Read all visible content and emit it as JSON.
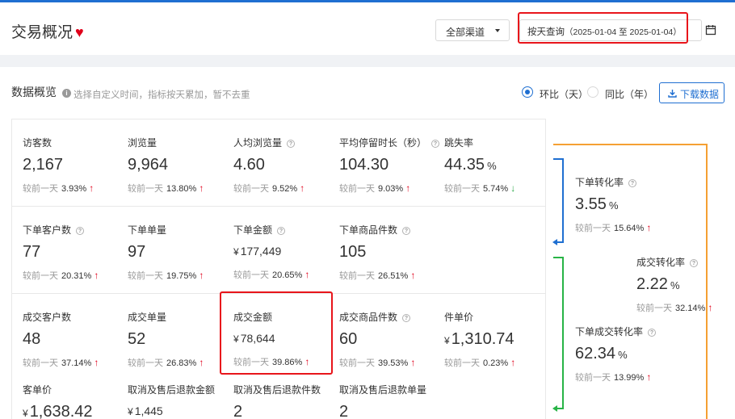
{
  "header": {
    "title": "交易概况",
    "channel": "全部渠道",
    "date_mode": "按天查询",
    "date_range": "（2025-01-04 至 2025-01-04）"
  },
  "overview": {
    "title": "数据概览",
    "hint": "选择自定义时间，指标按天累加，暂不去重",
    "compare_options": [
      {
        "label": "环比（天）",
        "selected": true
      },
      {
        "label": "同比（年）",
        "selected": false
      }
    ],
    "download_label": "下载数据",
    "compare_prefix": "较前一天"
  },
  "metrics": [
    {
      "label": "访客数",
      "value": "2,167",
      "change": "3.93%",
      "dir": "up"
    },
    {
      "label": "浏览量",
      "value": "9,964",
      "change": "13.80%",
      "dir": "up"
    },
    {
      "label": "人均浏览量",
      "value": "4.60",
      "change": "9.52%",
      "dir": "up"
    },
    {
      "label": "平均停留时长（秒）",
      "value": "104.30",
      "change": "9.03%",
      "dir": "up"
    },
    {
      "label": "跳失率",
      "value": "44.35",
      "unit": "%",
      "change": "5.74%",
      "dir": "down"
    },
    {
      "label": "下单客户数",
      "value": "77",
      "change": "20.31%",
      "dir": "up"
    },
    {
      "label": "下单单量",
      "value": "97",
      "change": "19.75%",
      "dir": "up"
    },
    {
      "label": "下单金额",
      "value": "177,449",
      "currency": "¥",
      "change": "20.65%",
      "dir": "up"
    },
    {
      "label": "下单商品件数",
      "value": "105",
      "change": "26.51%",
      "dir": "up"
    },
    {
      "label": "成交客户数",
      "value": "48",
      "change": "37.14%",
      "dir": "up"
    },
    {
      "label": "成交单量",
      "value": "52",
      "change": "26.83%",
      "dir": "up"
    },
    {
      "label": "成交金额",
      "value": "78,644",
      "currency": "¥",
      "change": "39.86%",
      "dir": "up"
    },
    {
      "label": "成交商品件数",
      "value": "60",
      "change": "39.53%",
      "dir": "up"
    },
    {
      "label": "件单价",
      "value": "1,310.74",
      "currency": "¥",
      "change": "0.23%",
      "dir": "up"
    },
    {
      "label": "客单价",
      "value": "1,638.42",
      "currency": "¥"
    },
    {
      "label": "取消及售后退款金额",
      "value": "1,445",
      "currency": "¥"
    },
    {
      "label": "取消及售后退款件数",
      "value": "2"
    },
    {
      "label": "取消及售后退款单量",
      "value": "2"
    }
  ],
  "conversions": [
    {
      "label": "下单转化率",
      "value": "3.55",
      "unit": "%",
      "change": "15.64%",
      "dir": "up"
    },
    {
      "label": "成交转化率",
      "value": "2.22",
      "unit": "%",
      "change": "32.14%",
      "dir": "up"
    },
    {
      "label": "下单成交转化率",
      "value": "62.34",
      "unit": "%",
      "change": "13.99%",
      "dir": "up"
    }
  ],
  "colors": {
    "primary": "#1f6fd1",
    "up": "#e0001a",
    "down": "#28a745",
    "flow_orange": "#f5a033",
    "flow_blue": "#1f6fd1",
    "flow_green": "#28b446",
    "highlight": "#e8151b"
  }
}
